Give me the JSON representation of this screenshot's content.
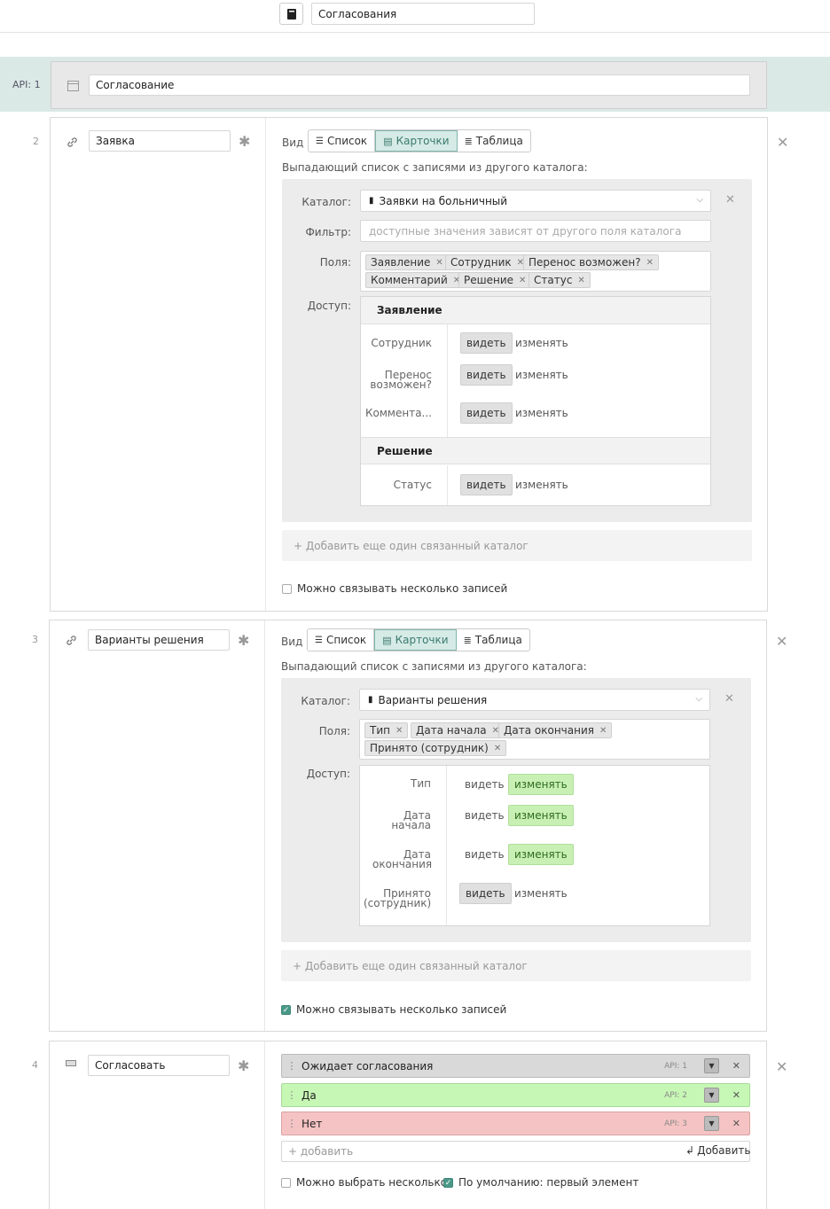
{
  "header": {
    "catalog_name": "Согласования"
  },
  "api_row": {
    "label": "API: 1",
    "name": "Согласование"
  },
  "common": {
    "view_label": "Вид",
    "view_options": [
      "Список",
      "Карточки",
      "Таблица"
    ],
    "dropdown_hint": "Выпадающий список с записями из другого каталога:",
    "catalog_label": "Каталог:",
    "filter_label": "Фильтр:",
    "fields_label": "Поля:",
    "access_label": "Доступ:",
    "view_btn": "видеть",
    "edit_btn": "изменять",
    "add_catalog": "+ Добавить еще один связанный каталог",
    "multi_link": "Можно связывать несколько записей"
  },
  "field2": {
    "num": "2",
    "name": "Заявка",
    "catalog": "Заявки на больничный",
    "filter_placeholder": "доступные значения зависят от другого поля каталога",
    "tags": [
      "Заявление",
      "Сотрудник",
      "Перенос возможен?",
      "Комментарий",
      "Решение",
      "Статус"
    ],
    "groups": [
      {
        "title": "Заявление",
        "fields": [
          "Сотрудник",
          "Перенос возможен?",
          "Коммента..."
        ]
      },
      {
        "title": "Решение",
        "fields": [
          "Статус"
        ]
      }
    ],
    "multi": false
  },
  "field3": {
    "num": "3",
    "name": "Варианты решения",
    "catalog": "Варианты решения",
    "tags": [
      "Тип",
      "Дата начала",
      "Дата окончания",
      "Принято (сотрудник)"
    ],
    "fields": [
      "Тип",
      "Дата начала",
      "Дата окончания",
      "Принято (сотрудник)"
    ],
    "multi": true
  },
  "field4": {
    "num": "4",
    "name": "Согласовать",
    "options": [
      {
        "label": "Ожидает согласования",
        "api": "API: 1",
        "color": "#d9d9d9"
      },
      {
        "label": "Да",
        "api": "API: 2",
        "color": "#c7f7b5"
      },
      {
        "label": "Нет",
        "api": "API: 3",
        "color": "#f5c3c3"
      }
    ],
    "add_placeholder": "+ добавить",
    "add_button": "Добавить",
    "multi_select": "Можно выбрать несколько",
    "default_first": "По умолчанию: первый элемент"
  }
}
